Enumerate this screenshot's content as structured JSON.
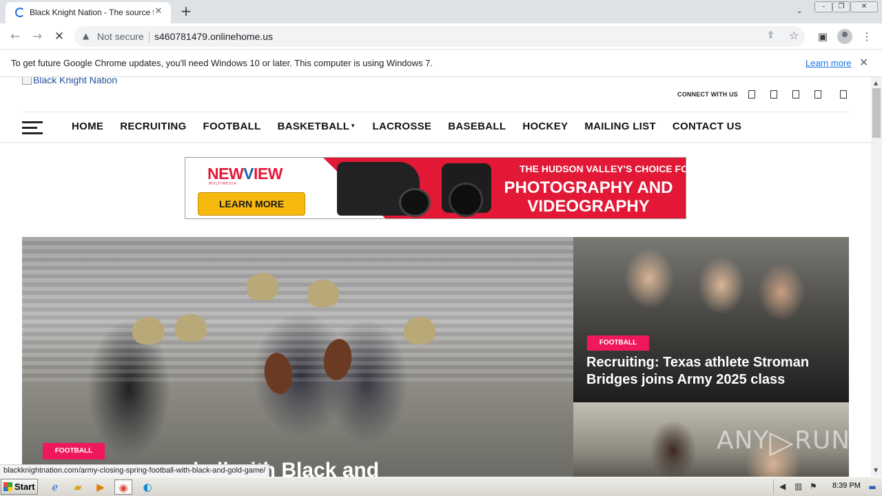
{
  "browser": {
    "tab_title": "Black Knight Nation - The source for",
    "new_tab_symbol": "+",
    "security_label": "Not secure",
    "url": "s460781479.onlinehome.us",
    "info_message": "To get future Google Chrome updates, you'll need Windows 10 or later. This computer is using Windows 7.",
    "info_link": "Learn more",
    "status_url": "blackknightnation.com/army-closing-spring-football-with-black-and-gold-game/"
  },
  "site": {
    "logo_alt": "Black Knight Nation",
    "connect_label": "CONNECT WITH US",
    "nav": [
      "HOME",
      "RECRUITING",
      "FOOTBALL",
      "BASKETBALL",
      "LACROSSE",
      "BASEBALL",
      "HOCKEY",
      "MAILING LIST",
      "CONTACT US"
    ],
    "dropdown_item": "BASKETBALL"
  },
  "ad": {
    "brand_a": "NEW",
    "brand_b": "V",
    "brand_c": "IEW",
    "brand_sub": "MULTIMEDIA",
    "cta": "LEARN MORE",
    "tagline_small": "THE HUDSON VALLEY'S CHOICE FOR",
    "tagline_large": "PHOTOGRAPHY AND VIDEOGRAPHY"
  },
  "articles": {
    "hero": {
      "category": "FOOTBALL",
      "headline_fragment": "ball with Black and"
    },
    "card1": {
      "category": "FOOTBALL",
      "headline": "Recruiting: Texas athlete Stroman Bridges joins Army 2025 class"
    }
  },
  "watermark": {
    "left": "ANY",
    "right": "RUN"
  },
  "taskbar": {
    "start_label": "Start",
    "clock": "8:39 PM"
  },
  "colors": {
    "accent_pink": "#f0185d",
    "ad_red": "#e31837",
    "ad_yellow": "#f6b90f",
    "link_blue": "#1a73e8"
  },
  "icons": [
    "loading-spinner-icon",
    "close-icon",
    "back-arrow-icon",
    "forward-arrow-icon",
    "stop-icon",
    "warning-icon",
    "share-icon",
    "star-icon",
    "side-panel-icon",
    "profile-icon",
    "kebab-menu-icon",
    "hamburger-icon",
    "windows-flag-icon",
    "ie-icon",
    "folder-icon",
    "media-player-icon",
    "chrome-icon",
    "edge-icon"
  ]
}
